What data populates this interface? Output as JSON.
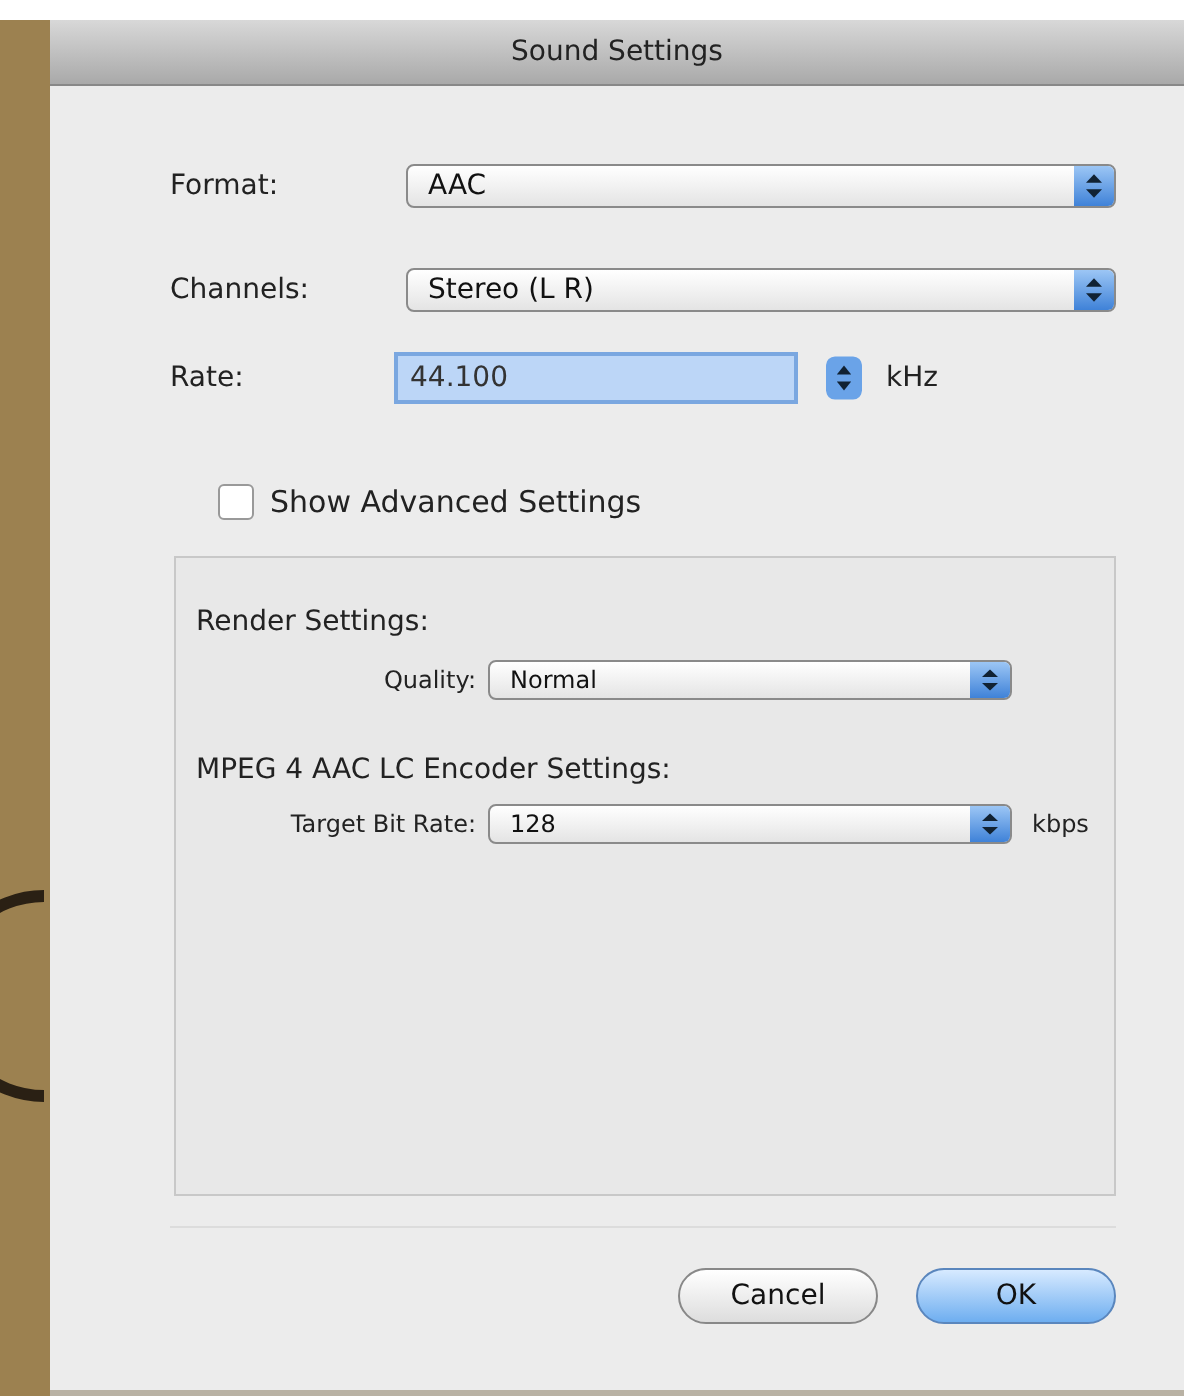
{
  "window": {
    "title": "Sound Settings"
  },
  "popups": [
    {
      "label": "Format:",
      "value": "AAC"
    },
    {
      "label": "Channels:",
      "value": "Stereo (L R)"
    }
  ],
  "rate": {
    "label": "Rate:",
    "value": "44.100",
    "unit": "kHz"
  },
  "advanced": {
    "label": "Show Advanced Settings",
    "checked": false
  },
  "group": {
    "render_heading": "Render Settings:",
    "quality": {
      "label": "Quality:",
      "value": "Normal"
    },
    "encoder_heading": "MPEG 4 AAC LC Encoder Settings:",
    "bitrate": {
      "label": "Target Bit Rate:",
      "value": "128",
      "unit": "kbps"
    }
  },
  "buttons": [
    {
      "label": "Cancel",
      "default": false
    },
    {
      "label": "OK",
      "default": true
    }
  ]
}
